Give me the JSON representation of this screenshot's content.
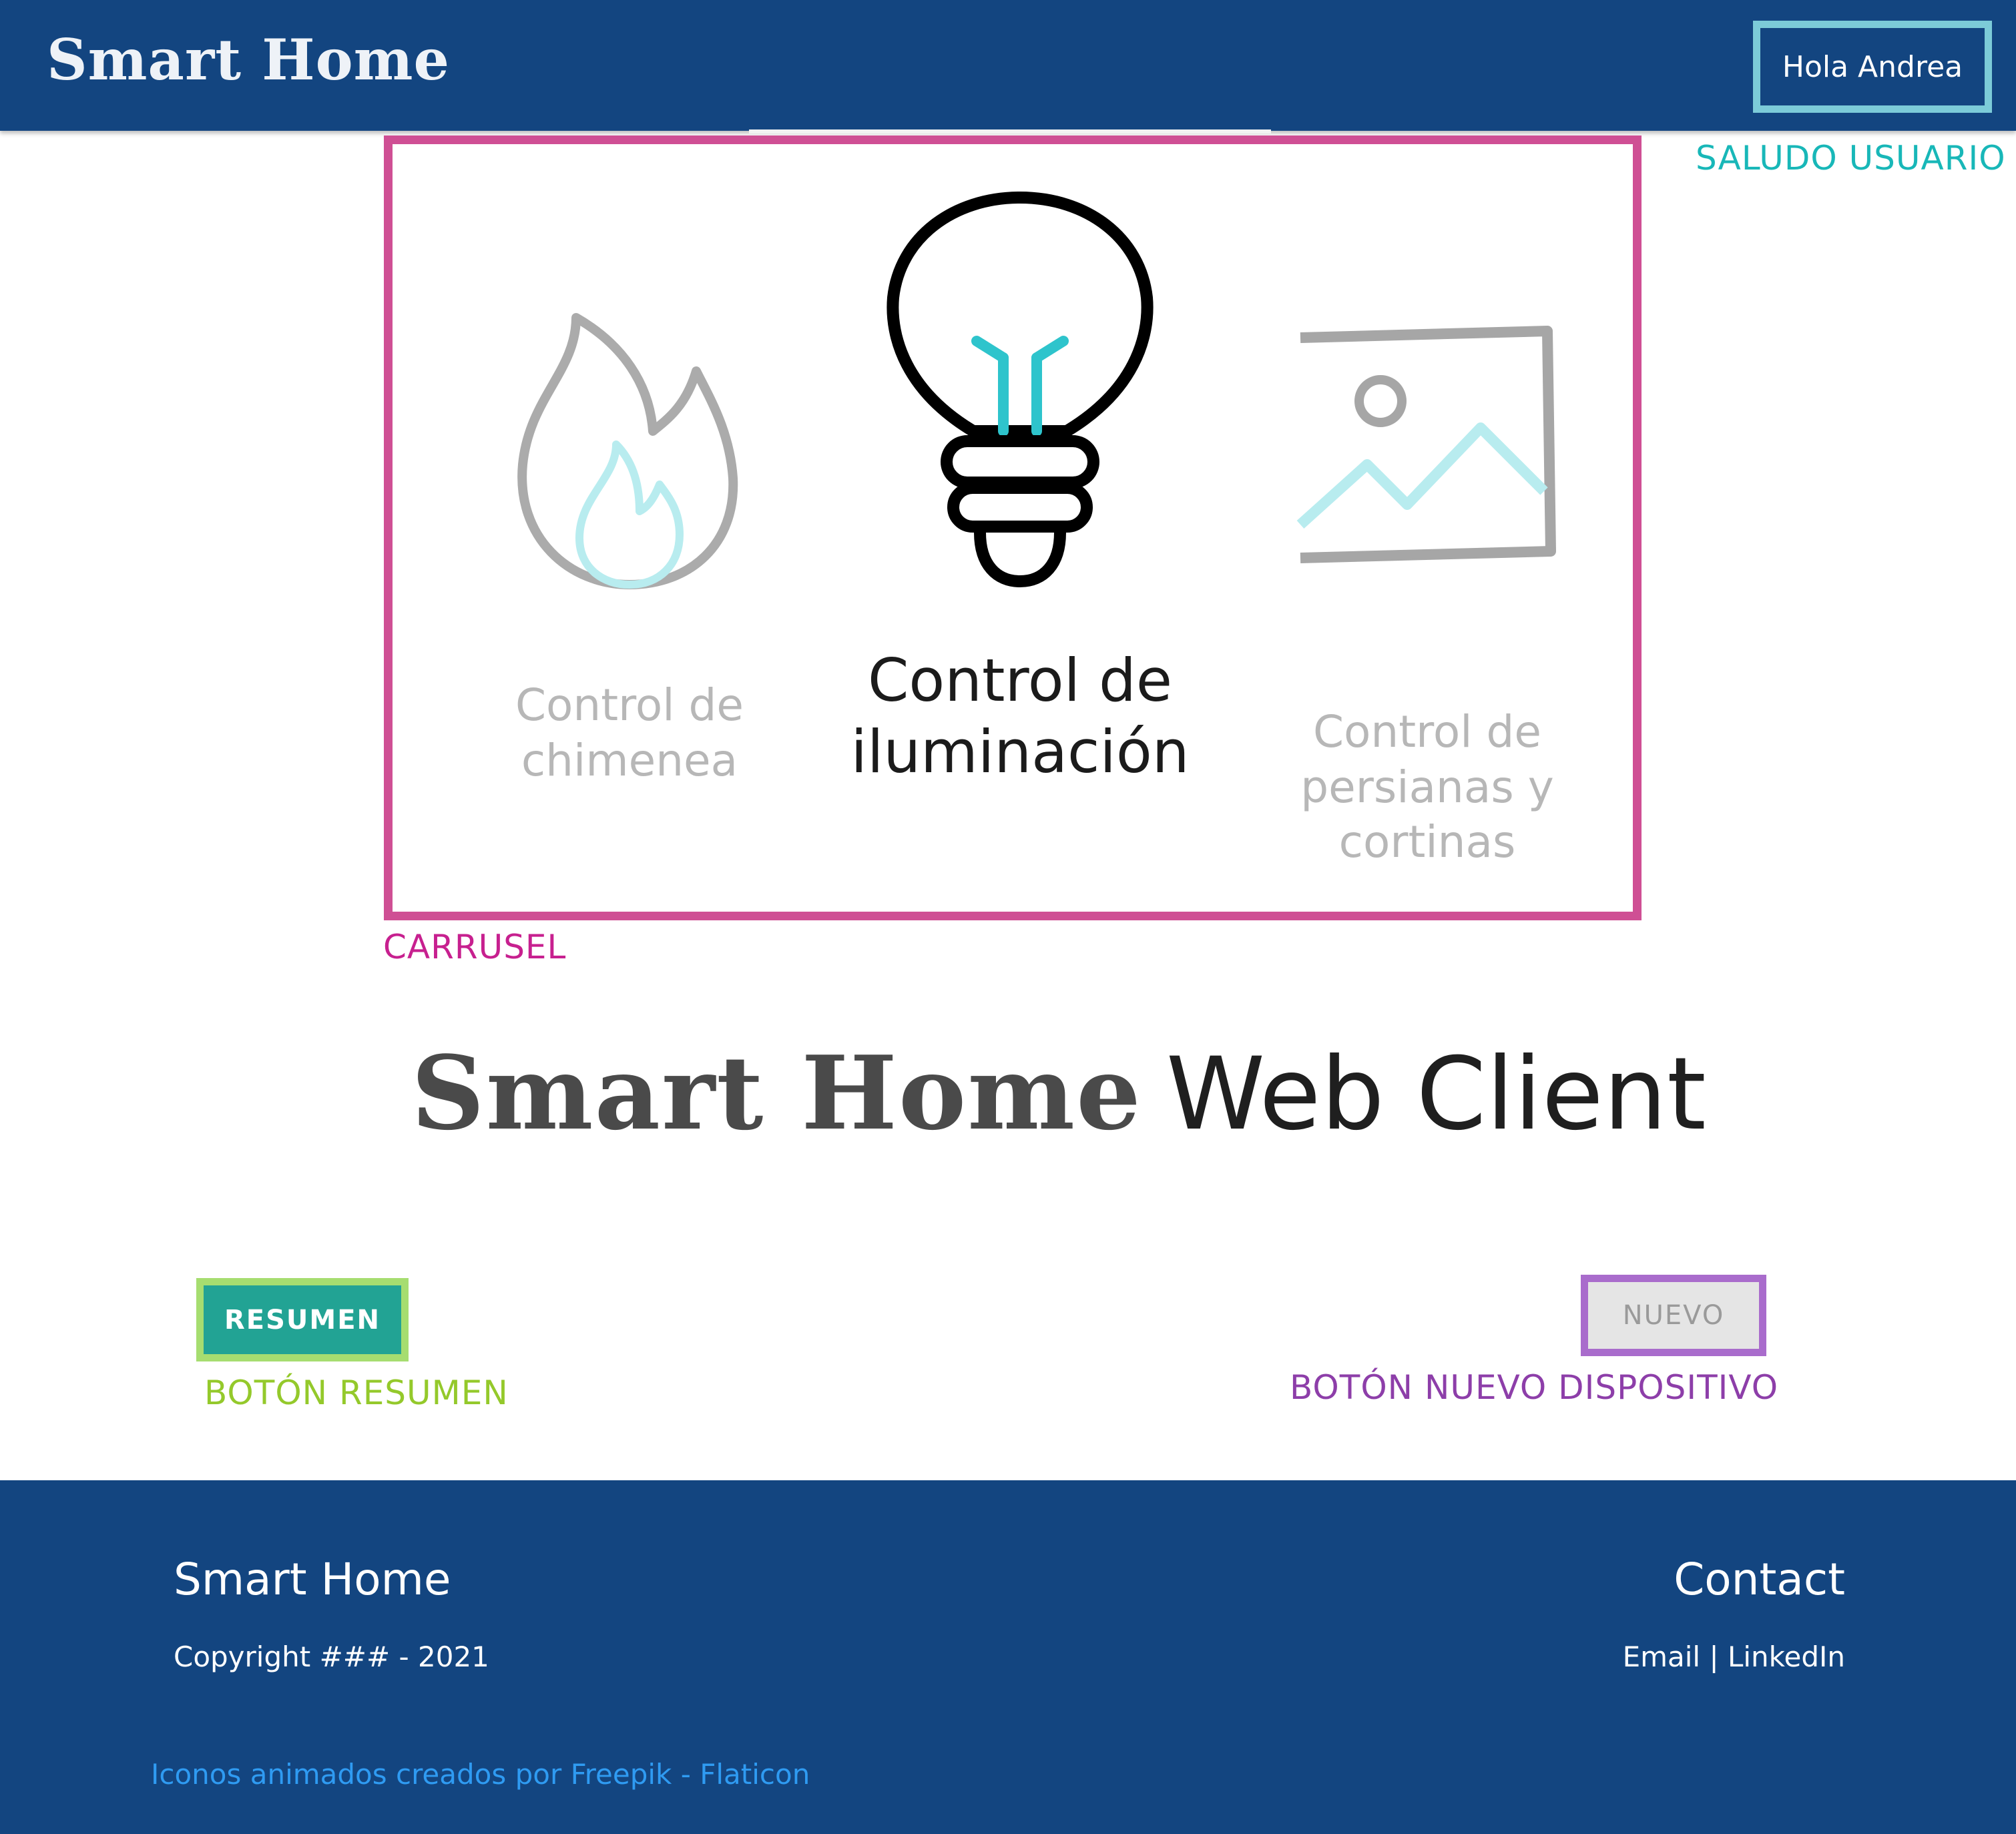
{
  "header": {
    "brand": "Smart Home",
    "greeting": "Hola Andrea"
  },
  "annotations": {
    "saludo_usuario": "SALUDO USUARIO",
    "carrusel": "CARRUSEL",
    "boton_resumen": "BOTÓN RESUMEN",
    "boton_nuevo": "BOTÓN NUEVO DISPOSITIVO"
  },
  "carousel": {
    "slides": [
      {
        "icon": "fire-icon",
        "line1": "Control de",
        "line2": "chimenea",
        "line3": "",
        "active": false
      },
      {
        "icon": "lightbulb-icon",
        "line1": "Control de",
        "line2": "iluminación",
        "line3": "",
        "active": true
      },
      {
        "icon": "image-icon",
        "line1": "Control de",
        "line2": "persianas y",
        "line3": "cortinas",
        "active": false
      }
    ]
  },
  "hero": {
    "brand": "Smart Home",
    "subtitle": "Web Client"
  },
  "buttons": {
    "resumen": "RESUMEN",
    "nuevo": "NUEVO"
  },
  "footer": {
    "brand": "Smart Home",
    "copyright": "Copyright ### - 2021",
    "contact_title": "Contact",
    "email": "Email",
    "separator": "|",
    "linkedin": "LinkedIn",
    "credit": "Iconos animados creados por Freepik - Flaticon"
  },
  "colors": {
    "navy": "#134580",
    "teal_accent": "#2ec4cc",
    "carousel_border": "#cf4f94",
    "greet_border": "#7ccbd8",
    "resumen_bg": "#22a394",
    "resumen_border": "#a6dd70",
    "nuevo_border": "#a96ccc",
    "credit_link": "#2f9bf2"
  }
}
